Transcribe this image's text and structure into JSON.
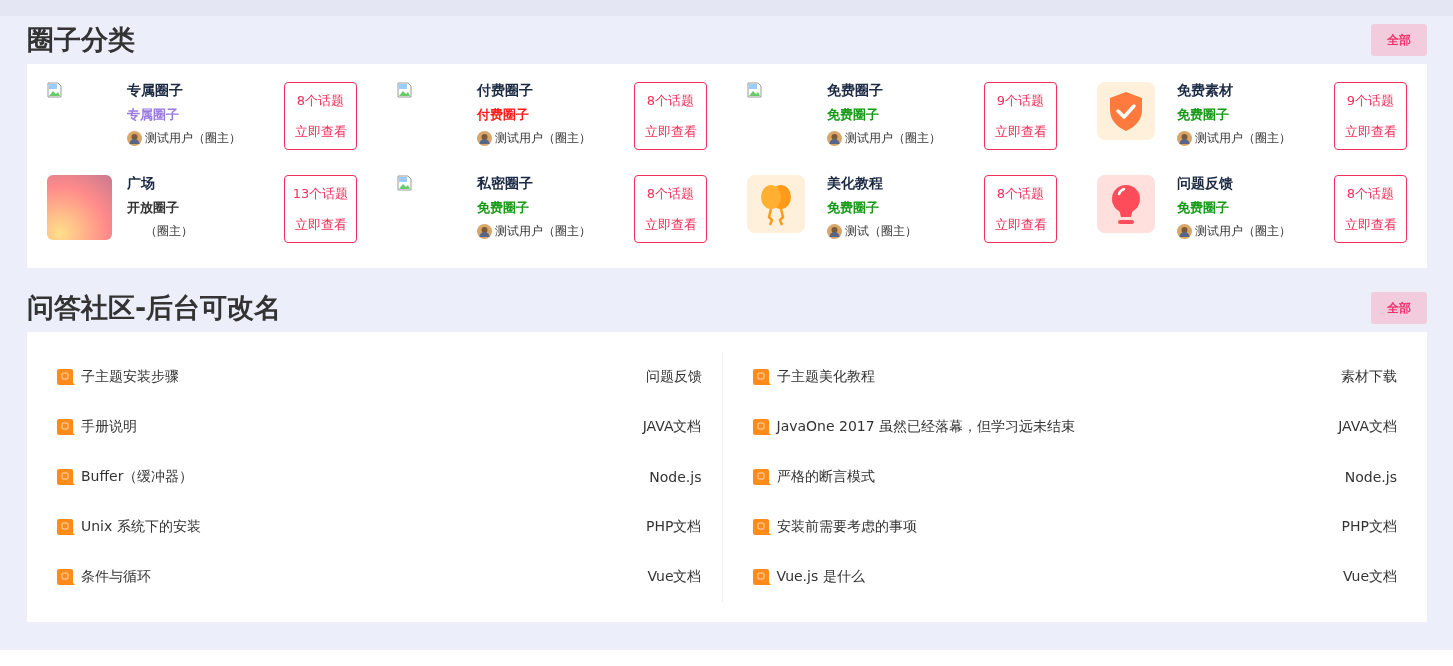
{
  "circles_section": {
    "title": "圈子分类",
    "all_button": "全部",
    "circles": [
      {
        "name": "专属圈子",
        "kind": "broken",
        "tag": "专属圈子",
        "color": "#9b7be0",
        "avatar": true,
        "owner": "测试用户（圈主）",
        "topics": "8个话题",
        "view": "立即查看"
      },
      {
        "name": "付费圈子",
        "kind": "broken",
        "tag": "付费圈子",
        "color": "#ff1a1a",
        "avatar": true,
        "owner": "测试用户（圈主）",
        "topics": "8个话题",
        "view": "立即查看"
      },
      {
        "name": "免费圈子",
        "kind": "broken",
        "tag": "免费圈子",
        "color": "#159a15",
        "avatar": true,
        "owner": "测试用户（圈主）",
        "topics": "9个话题",
        "view": "立即查看"
      },
      {
        "name": "免费素材",
        "kind": "shield",
        "tag": "免费圈子",
        "color": "#159a15",
        "avatar": true,
        "owner": "测试用户（圈主）",
        "topics": "9个话题",
        "view": "立即查看"
      },
      {
        "name": "广场",
        "kind": "gradient",
        "tag": "开放圈子",
        "color": "#333333",
        "avatar": false,
        "owner": "（圈主）",
        "topics": "13个话题",
        "view": "立即查看"
      },
      {
        "name": "私密圈子",
        "kind": "broken",
        "tag": "免费圈子",
        "color": "#159a15",
        "avatar": true,
        "owner": "测试用户（圈主）",
        "topics": "8个话题",
        "view": "立即查看"
      },
      {
        "name": "美化教程",
        "kind": "balloon",
        "tag": "免费圈子",
        "color": "#159a15",
        "avatar": true,
        "owner": "测试（圈主）",
        "topics": "8个话题",
        "view": "立即查看"
      },
      {
        "name": "问题反馈",
        "kind": "bulb",
        "tag": "免费圈子",
        "color": "#159a15",
        "avatar": true,
        "owner": "测试用户（圈主）",
        "topics": "8个话题",
        "view": "立即查看"
      }
    ]
  },
  "qa_section": {
    "title": "问答社区-后台可改名",
    "all_button": "全部",
    "columns": [
      [
        {
          "title": "子主题安装步骤",
          "category": "问题反馈"
        },
        {
          "title": "手册说明",
          "category": "JAVA文档"
        },
        {
          "title": "Buffer（缓冲器）",
          "category": "Node.js"
        },
        {
          "title": "Unix 系统下的安装",
          "category": "PHP文档"
        },
        {
          "title": "条件与循环",
          "category": "Vue文档"
        }
      ],
      [
        {
          "title": "子主题美化教程",
          "category": "素材下载"
        },
        {
          "title": "JavaOne 2017 虽然已经落幕，但学习远未结束",
          "category": "JAVA文档"
        },
        {
          "title": "严格的断言模式",
          "category": "Node.js"
        },
        {
          "title": "安装前需要考虑的事项",
          "category": "PHP文档"
        },
        {
          "title": "Vue.js 是什么",
          "category": "Vue文档"
        }
      ]
    ]
  }
}
